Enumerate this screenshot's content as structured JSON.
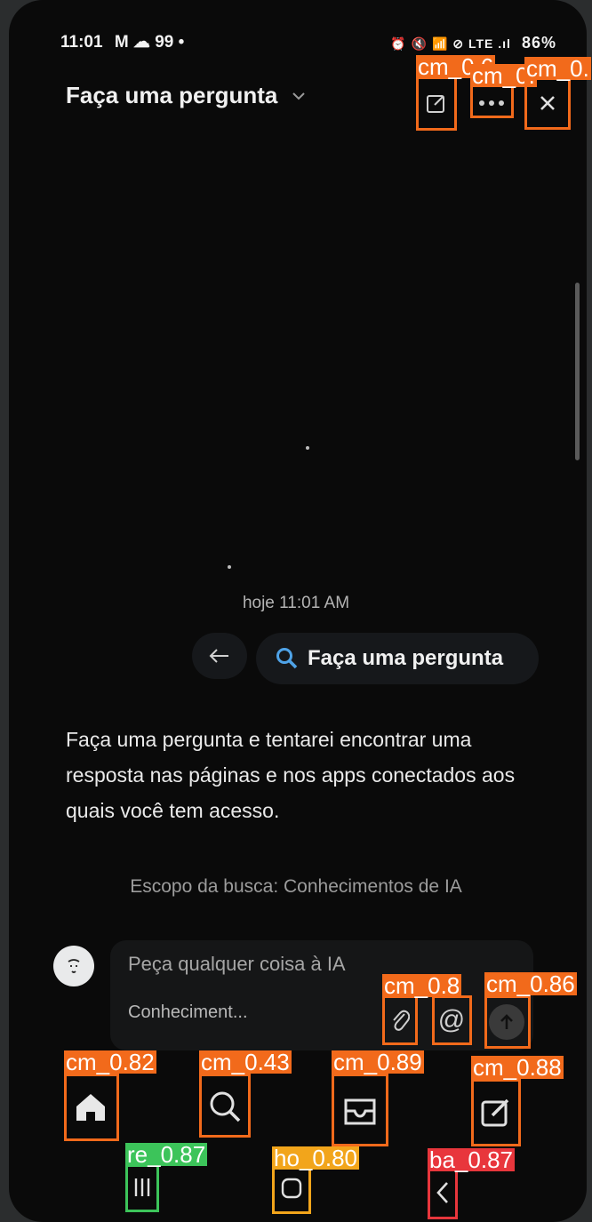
{
  "status_bar": {
    "time": "11:01",
    "left_icons": "M ☁ 99 •",
    "right_icons": "⏰ 🔇 📶 ⊘ LTE .ıl",
    "battery": "86%"
  },
  "header": {
    "title": "Faça uma pergunta",
    "chevron_icon": "chevron-down-icon",
    "buttons": [
      "edit-icon",
      "more-icon",
      "close-icon"
    ]
  },
  "chat": {
    "timestamp": "hoje 11:01 AM",
    "query_label": "Faça uma pergunta",
    "answer": "Faça uma pergunta e tentarei encontrar uma resposta nas páginas e nos apps conectados aos quais você tem acesso.",
    "scope": "Escopo da busca: Conhecimentos de IA"
  },
  "composer": {
    "placeholder": "Peça qualquer coisa à IA",
    "scope_chip": "Conheciment..."
  },
  "bottom_nav": [
    "home-icon",
    "search-icon",
    "inbox-icon",
    "compose-icon"
  ],
  "system_nav": [
    "recents-icon",
    "home-circle-icon",
    "back-icon"
  ],
  "detections": [
    {
      "label": "cm_0.6",
      "color": "#f26a1b"
    },
    {
      "label": "cm_0.",
      "color": "#f26a1b"
    },
    {
      "label": "cm_0.",
      "color": "#f26a1b"
    },
    {
      "label": "cm_0.8",
      "color": "#f26a1b"
    },
    {
      "label": "cm_0.86",
      "color": "#f26a1b"
    },
    {
      "label": "cm_0.82",
      "color": "#f26a1b"
    },
    {
      "label": "cm_0.43",
      "color": "#f26a1b"
    },
    {
      "label": "cm_0.89",
      "color": "#f26a1b"
    },
    {
      "label": "cm_0.88",
      "color": "#f26a1b"
    },
    {
      "label": "re_0.87",
      "color": "#3cc45a"
    },
    {
      "label": "ho_0.80",
      "color": "#f2a51b"
    },
    {
      "label": "ba_0.87",
      "color": "#e8363c"
    }
  ]
}
